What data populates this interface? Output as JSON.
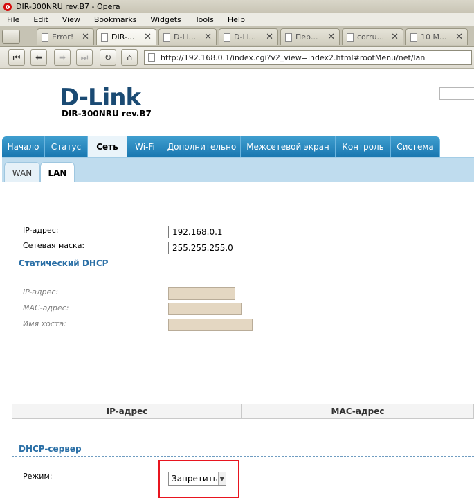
{
  "window": {
    "title": "DIR-300NRU rev.B7 - Opera"
  },
  "menu": [
    "File",
    "Edit",
    "View",
    "Bookmarks",
    "Widgets",
    "Tools",
    "Help"
  ],
  "tabs": [
    {
      "label": "Error!"
    },
    {
      "label": "DIR-..."
    },
    {
      "label": "D-Li..."
    },
    {
      "label": "D-Li..."
    },
    {
      "label": "Пер..."
    },
    {
      "label": "corru..."
    },
    {
      "label": "10 M..."
    }
  ],
  "address": {
    "url": "http://192.168.0.1/index.cgi?v2_view=index2.html#rootMenu/net/lan"
  },
  "brand": {
    "logo": "D-Link",
    "model": "DIR-300NRU rev.B7"
  },
  "nav": [
    "Начало",
    "Статус",
    "Сеть",
    "Wi-Fi",
    "Дополнительно",
    "Межсетевой экран",
    "Контроль",
    "Система"
  ],
  "subtabs": [
    "WAN",
    "LAN"
  ],
  "lan": {
    "ip_label": "IP-адрес:",
    "ip_value": "192.168.0.1",
    "mask_label": "Сетевая маска:",
    "mask_value": "255.255.255.0"
  },
  "static_dhcp": {
    "title": "Статический DHCP",
    "ip_label": "IP-адрес:",
    "mac_label": "MAC-адрес:",
    "host_label": "Имя хоста:",
    "col_ip": "IP-адрес",
    "col_mac": "MAC-адрес"
  },
  "dhcp_server": {
    "title": "DHCP-сервер",
    "mode_label": "Режим:",
    "mode_value": "Запретить"
  },
  "colors": {
    "nav_blue": "#1977b0",
    "section_blue": "#2a6fa6",
    "highlight_red": "#e8151f"
  }
}
